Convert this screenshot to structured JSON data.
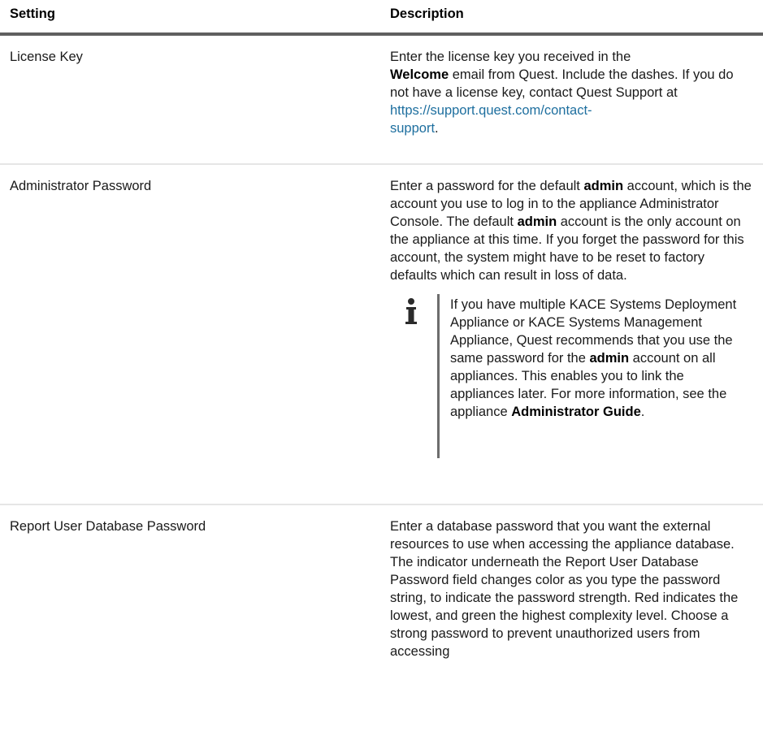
{
  "header": {
    "setting": "Setting",
    "description": "Description"
  },
  "rows": [
    {
      "setting": "License Key",
      "desc": {
        "t1": "Enter the license key you received in the",
        "b1": "Welcome",
        "t2": " email from Quest. Include the dashes. If you do not have a license key, contact Quest Support at ",
        "link1": "https://support.quest.com/contact-",
        "link2": "support",
        "t3": "."
      }
    },
    {
      "setting": "Administrator Password",
      "desc": {
        "t1": "Enter a password for the default ",
        "b1": "admin",
        "t2": " account, which is the account you use to log in to the appliance Administrator Console. The default ",
        "b2": "admin",
        "t3": " account is the only account on the appliance at this time. If you forget the password for this account, the system might have to be reset to factory defaults which can result in loss of data."
      },
      "note": {
        "icon": "info-icon",
        "t1": "If you have multiple KACE Systems Deployment Appliance or KACE Systems Management Appliance, Quest recommends that you use the same password for the ",
        "b1": "admin",
        "t2": " account on all appliances. This enables you to link the appliances later. For more information, see the appliance ",
        "b2": "Administrator Guide",
        "t3": "."
      }
    },
    {
      "setting": "Report User Database Password",
      "desc": {
        "t1": "Enter a database password that you want the external resources to use when accessing the appliance database. The indicator underneath the Report User Database Password field changes color as you type the password string, to indicate the password strength. Red indicates the lowest, and green the highest complexity level. Choose a strong password to prevent unauthorized users from accessing"
      }
    }
  ],
  "colors": {
    "link": "#1e6f9f",
    "header_rule": "#5f5f5f",
    "row_rule": "#e6e6e6",
    "note_bar": "#6d6d6d"
  }
}
